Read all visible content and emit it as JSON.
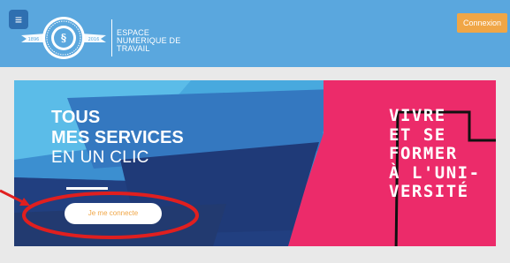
{
  "header": {
    "menu_icon": "hamburger-icon",
    "brand_lines": [
      "ESPACE",
      "NUMERIQUE DE",
      "TRAVAIL"
    ],
    "login_label": "Connexion",
    "logo_years": [
      "1896",
      "2016"
    ]
  },
  "banner": {
    "headline_line1": "TOUS",
    "headline_line2": "MES SERVICES",
    "headline_line3": "EN UN CLIC",
    "cta_label": "Je me connecte",
    "slogan_lines": [
      "VIVRE",
      "ET SE",
      "FORMER",
      "À L'UNI-",
      "VERSITÉ"
    ]
  },
  "colors": {
    "header_bg": "#5aa7de",
    "accent_orange": "#f0a646",
    "pink": "#ec2b6a",
    "annotation_red": "#e01f1f"
  }
}
